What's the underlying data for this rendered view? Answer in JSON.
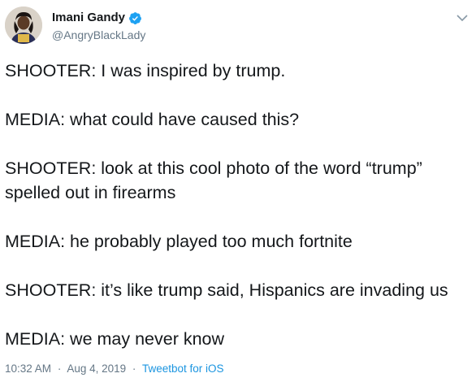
{
  "author": {
    "display_name": "Imani Gandy",
    "handle": "@AngryBlackLady",
    "verified": true,
    "avatar_icon": "profile-photo"
  },
  "tweet": {
    "lines": [
      "SHOOTER: I was inspired by trump.",
      "MEDIA: what could have caused this?",
      "SHOOTER: look at this cool photo of the word “trump”",
      "spelled out in firearms",
      "MEDIA: he probably played too much fortnite",
      "SHOOTER: it’s like trump said, Hispanics are invading us",
      "MEDIA: we may never know"
    ]
  },
  "meta": {
    "time": "10:32 AM",
    "separator": "·",
    "date": "Aug 4, 2019",
    "source": "Tweetbot for iOS"
  },
  "colors": {
    "text": "#14171a",
    "muted": "#657786",
    "link": "#1b95e0",
    "verified": "#1da1f2"
  },
  "icons": {
    "verified": "verified-badge-icon",
    "more": "chevron-down-icon"
  }
}
